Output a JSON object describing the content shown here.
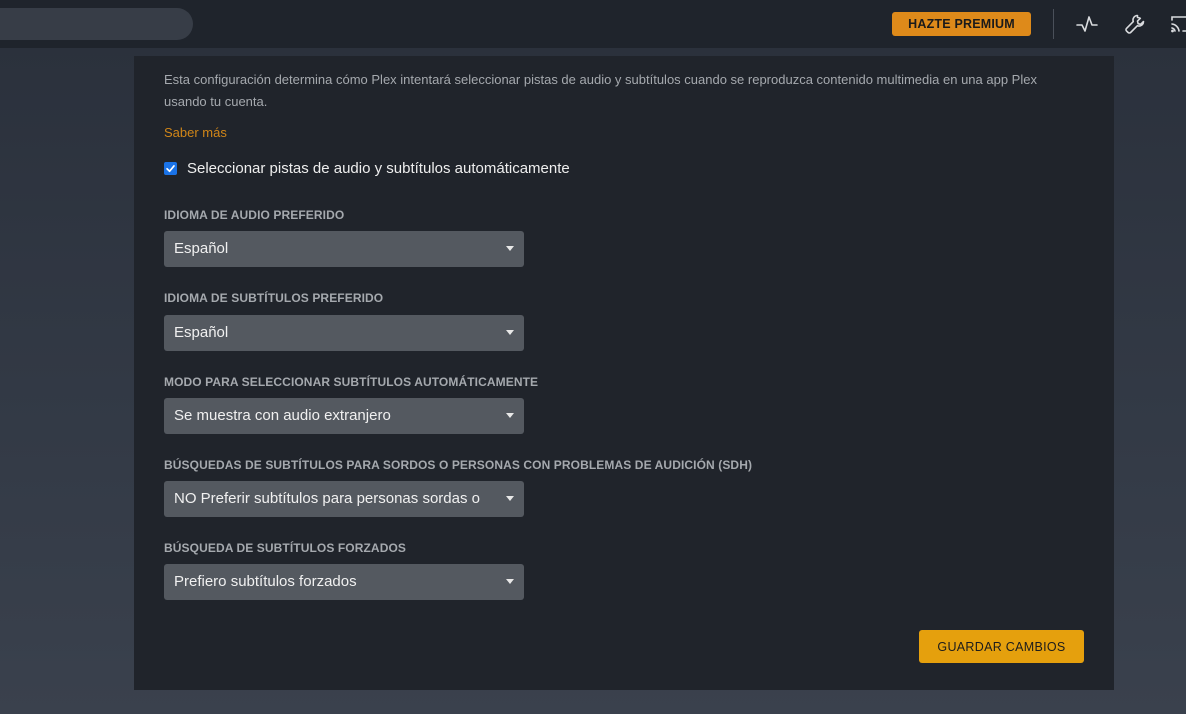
{
  "header": {
    "premium_label": "HAZTE PREMIUM",
    "icons": [
      "activity-icon",
      "wrench-icon",
      "cast-icon"
    ]
  },
  "settings": {
    "description": "Esta configuración determina cómo Plex intentará seleccionar pistas de audio y subtítulos cuando se reproduzca contenido multimedia en una app Plex usando tu cuenta.",
    "learn_more": "Saber más",
    "auto_select": {
      "label": "Seleccionar pistas de audio y subtítulos automáticamente",
      "checked": true
    },
    "fields": [
      {
        "label": "IDIOMA DE AUDIO PREFERIDO",
        "value": "Español"
      },
      {
        "label": "IDIOMA DE SUBTÍTULOS PREFERIDO",
        "value": "Español"
      },
      {
        "label": "MODO PARA SELECCIONAR SUBTÍTULOS AUTOMÁTICAMENTE",
        "value": "Se muestra con audio extranjero"
      },
      {
        "label": "BÚSQUEDAS DE SUBTÍTULOS PARA SORDOS O PERSONAS CON PROBLEMAS DE AUDICIÓN (SDH)",
        "value": "NO Preferir subtítulos para personas sordas o"
      },
      {
        "label": "BÚSQUEDA DE SUBTÍTULOS FORZADOS",
        "value": "Prefiero subtítulos forzados"
      }
    ],
    "save_label": "GUARDAR CAMBIOS"
  },
  "colors": {
    "accent": "#e5a00d",
    "premium": "#de8a1a",
    "link": "#d18618",
    "panel": "#20242b",
    "checkbox": "#1a73e8"
  }
}
